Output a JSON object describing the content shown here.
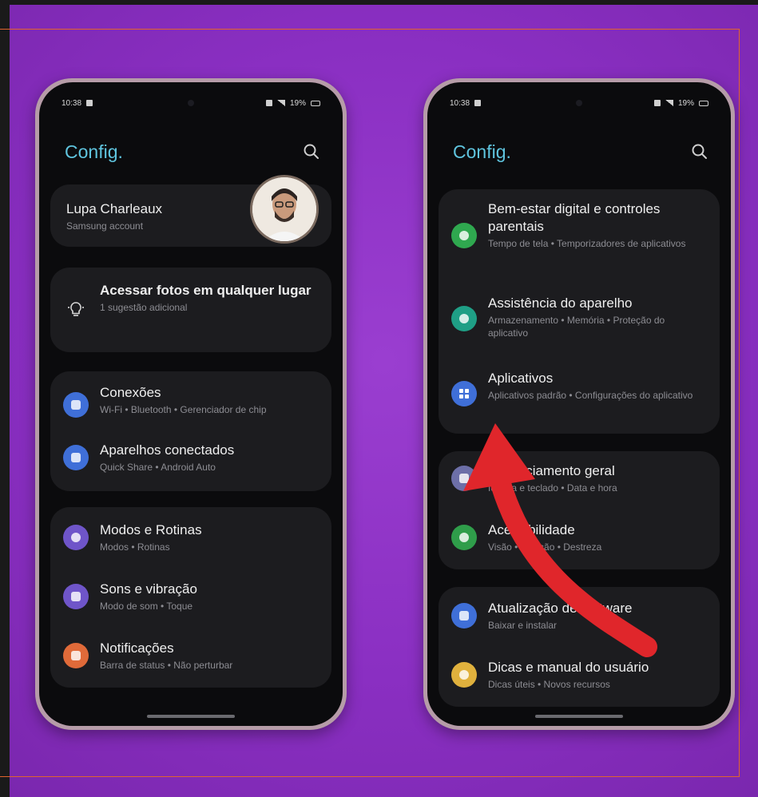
{
  "left_phone": {
    "status": {
      "time": "10:38",
      "battery": "19%"
    },
    "header": {
      "title": "Config."
    },
    "profile": {
      "name": "Lupa Charleaux",
      "account": "Samsung account"
    },
    "suggestion": {
      "title": "Acessar fotos em qualquer lugar",
      "subtitle": "1 sugestão adicional"
    },
    "group1": [
      {
        "title": "Conexões",
        "subtitle": "Wi-Fi • Bluetooth • Gerenciador de chip",
        "icon": "wifi-icon",
        "color": "#3f6fd8"
      },
      {
        "title": "Aparelhos conectados",
        "subtitle": "Quick Share • Android Auto",
        "icon": "devices-icon",
        "color": "#3f6fd8"
      }
    ],
    "group2": [
      {
        "title": "Modos e Rotinas",
        "subtitle": "Modos • Rotinas",
        "icon": "modes-icon",
        "color": "#6f55c9"
      },
      {
        "title": "Sons e vibração",
        "subtitle": "Modo de som • Toque",
        "icon": "sound-icon",
        "color": "#6f55c9"
      },
      {
        "title": "Notificações",
        "subtitle": "Barra de status • Não perturbar",
        "icon": "notification-icon",
        "color": "#e06a39"
      }
    ]
  },
  "right_phone": {
    "status": {
      "time": "10:38",
      "battery": "19%"
    },
    "header": {
      "title": "Config."
    },
    "group1": [
      {
        "title": "Bem-estar digital e controles parentais",
        "subtitle": "Tempo de tela • Temporizadores de aplicativos",
        "icon": "wellbeing-icon",
        "color": "#2fa84f"
      },
      {
        "title": "Assistência do aparelho",
        "subtitle": "Armazenamento • Memória • Proteção do aplicativo",
        "icon": "device-care-icon",
        "color": "#1f9f86"
      },
      {
        "title": "Aplicativos",
        "subtitle": "Aplicativos padrão • Configurações do aplicativo",
        "icon": "apps-icon",
        "color": "#3f6fd8"
      }
    ],
    "group2": [
      {
        "title": "Gerenciamento geral",
        "subtitle": "Idioma e teclado • Data e hora",
        "icon": "general-icon",
        "color": "#6d6fa8"
      },
      {
        "title": "Acessibilidade",
        "subtitle": "Visão • Audição • Destreza",
        "icon": "accessibility-icon",
        "color": "#2f9d4a"
      }
    ],
    "group3": [
      {
        "title": "Atualização de software",
        "subtitle": "Baixar e instalar",
        "icon": "update-icon",
        "color": "#3f6fd8"
      },
      {
        "title": "Dicas e manual do usuário",
        "subtitle": "Dicas úteis • Novos recursos",
        "icon": "tips-icon",
        "color": "#e0b13d"
      }
    ]
  },
  "annotation": {
    "arrow_color": "#e0262b",
    "target": "Aplicativos"
  }
}
